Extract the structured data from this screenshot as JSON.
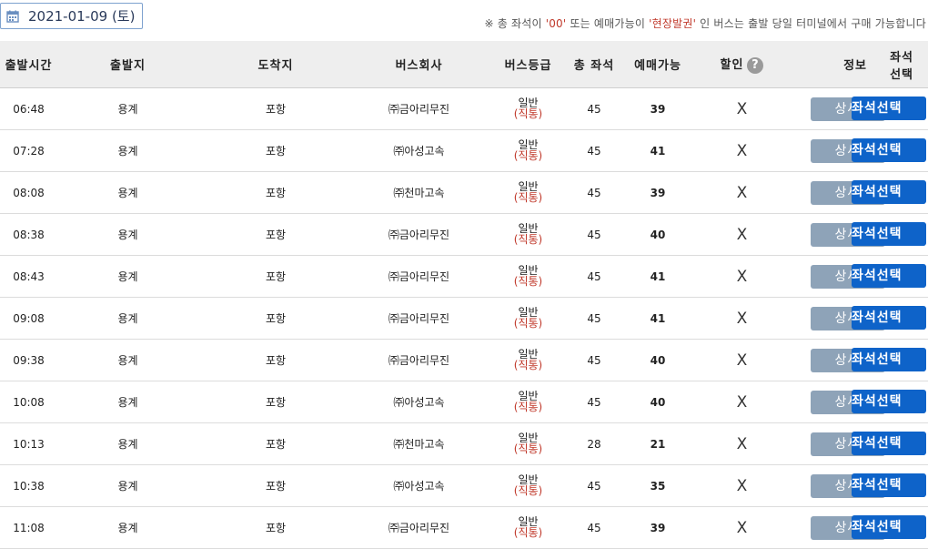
{
  "date_selector": {
    "value": "2021-01-09 (토)"
  },
  "notice": {
    "prefix": "※ 총 좌석이 ",
    "code": "'00'",
    "middle": " 또는 예매가능이 ",
    "onsite": "'현장발권'",
    "suffix": " 인 버스는 출발 당일 터미널에서 구매 가능합니다"
  },
  "table": {
    "headers": {
      "time": "출발시간",
      "origin": "출발지",
      "destination": "도착지",
      "company": "버스회사",
      "grade": "버스등급",
      "total": "총 좌석",
      "available": "예매가능",
      "discount": "할인",
      "info": "정보",
      "select": "좌석선택"
    },
    "help_icon": "?",
    "rows": [
      {
        "time": "06:48",
        "origin": "용계",
        "destination": "포항",
        "company": "㈜금아리무진",
        "grade": "일반",
        "grade_type": "(직통)",
        "total": "45",
        "available": "39",
        "discount": "X",
        "detail": "상세보기",
        "select": "좌석선택"
      },
      {
        "time": "07:28",
        "origin": "용계",
        "destination": "포항",
        "company": "㈜아성고속",
        "grade": "일반",
        "grade_type": "(직통)",
        "total": "45",
        "available": "41",
        "discount": "X",
        "detail": "상세보기",
        "select": "좌석선택"
      },
      {
        "time": "08:08",
        "origin": "용계",
        "destination": "포항",
        "company": "㈜천마고속",
        "grade": "일반",
        "grade_type": "(직통)",
        "total": "45",
        "available": "39",
        "discount": "X",
        "detail": "상세보기",
        "select": "좌석선택"
      },
      {
        "time": "08:38",
        "origin": "용계",
        "destination": "포항",
        "company": "㈜금아리무진",
        "grade": "일반",
        "grade_type": "(직통)",
        "total": "45",
        "available": "40",
        "discount": "X",
        "detail": "상세보기",
        "select": "좌석선택"
      },
      {
        "time": "08:43",
        "origin": "용계",
        "destination": "포항",
        "company": "㈜금아리무진",
        "grade": "일반",
        "grade_type": "(직통)",
        "total": "45",
        "available": "41",
        "discount": "X",
        "detail": "상세보기",
        "select": "좌석선택"
      },
      {
        "time": "09:08",
        "origin": "용계",
        "destination": "포항",
        "company": "㈜금아리무진",
        "grade": "일반",
        "grade_type": "(직통)",
        "total": "45",
        "available": "41",
        "discount": "X",
        "detail": "상세보기",
        "select": "좌석선택"
      },
      {
        "time": "09:38",
        "origin": "용계",
        "destination": "포항",
        "company": "㈜금아리무진",
        "grade": "일반",
        "grade_type": "(직통)",
        "total": "45",
        "available": "40",
        "discount": "X",
        "detail": "상세보기",
        "select": "좌석선택"
      },
      {
        "time": "10:08",
        "origin": "용계",
        "destination": "포항",
        "company": "㈜아성고속",
        "grade": "일반",
        "grade_type": "(직통)",
        "total": "45",
        "available": "40",
        "discount": "X",
        "detail": "상세보기",
        "select": "좌석선택"
      },
      {
        "time": "10:13",
        "origin": "용계",
        "destination": "포항",
        "company": "㈜천마고속",
        "grade": "일반",
        "grade_type": "(직통)",
        "total": "28",
        "available": "21",
        "discount": "X",
        "detail": "상세보기",
        "select": "좌석선택"
      },
      {
        "time": "10:38",
        "origin": "용계",
        "destination": "포항",
        "company": "㈜아성고속",
        "grade": "일반",
        "grade_type": "(직통)",
        "total": "45",
        "available": "35",
        "discount": "X",
        "detail": "상세보기",
        "select": "좌석선택"
      },
      {
        "time": "11:08",
        "origin": "용계",
        "destination": "포항",
        "company": "㈜금아리무진",
        "grade": "일반",
        "grade_type": "(직통)",
        "total": "45",
        "available": "39",
        "discount": "X",
        "detail": "상세보기",
        "select": "좌석선택"
      }
    ]
  },
  "colors": {
    "detail_button": "#8ea3b8",
    "select_button": "#0e63c9",
    "notice_highlight": "#c0392b"
  },
  "icons": {
    "date": "calendar-icon",
    "discount_help": "question-icon"
  }
}
